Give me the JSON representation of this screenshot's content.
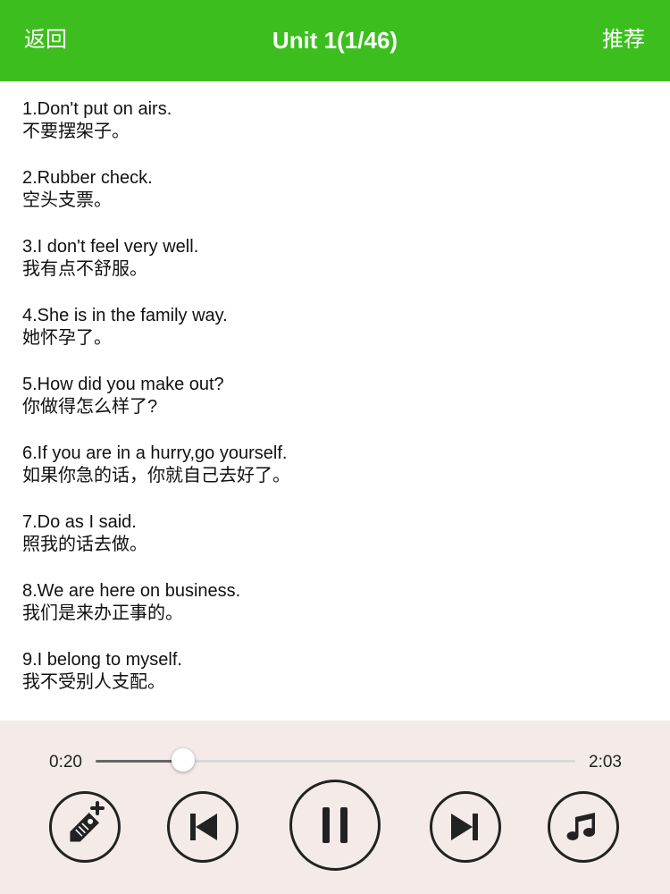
{
  "nav": {
    "back_label": "返回",
    "title": "Unit 1(1/46)",
    "recommend_label": "推荐",
    "color": "#3cbf1e"
  },
  "sentences": [
    {
      "en": "1.Don't put on airs.",
      "zh": "不要摆架子。"
    },
    {
      "en": "2.Rubber check.",
      "zh": "空头支票。"
    },
    {
      "en": "3.I don't feel very well.",
      "zh": "我有点不舒服。"
    },
    {
      "en": "4.She is in the family way.",
      "zh": "她怀孕了。"
    },
    {
      "en": "5.How did you make out?",
      "zh": "你做得怎么样了?"
    },
    {
      "en": "6.If you are in a hurry,go yourself.",
      "zh": "如果你急的话，你就自己去好了。"
    },
    {
      "en": "7.Do as I said.",
      "zh": "照我的话去做。"
    },
    {
      "en": "8.We are here on business.",
      "zh": "我们是来办正事的。"
    },
    {
      "en": "9.I belong to myself.",
      "zh": "我不受别人支配。"
    }
  ],
  "player": {
    "elapsed": "0:20",
    "total": "2:03",
    "progress": 0.183,
    "background": "#f4ebe8",
    "controls": [
      {
        "name": "add-tag-button",
        "icon": "tag-plus-icon"
      },
      {
        "name": "previous-button",
        "icon": "skip-previous-icon"
      },
      {
        "name": "pause-button",
        "icon": "pause-icon"
      },
      {
        "name": "next-button",
        "icon": "skip-next-icon"
      },
      {
        "name": "music-button",
        "icon": "music-note-icon"
      }
    ]
  }
}
